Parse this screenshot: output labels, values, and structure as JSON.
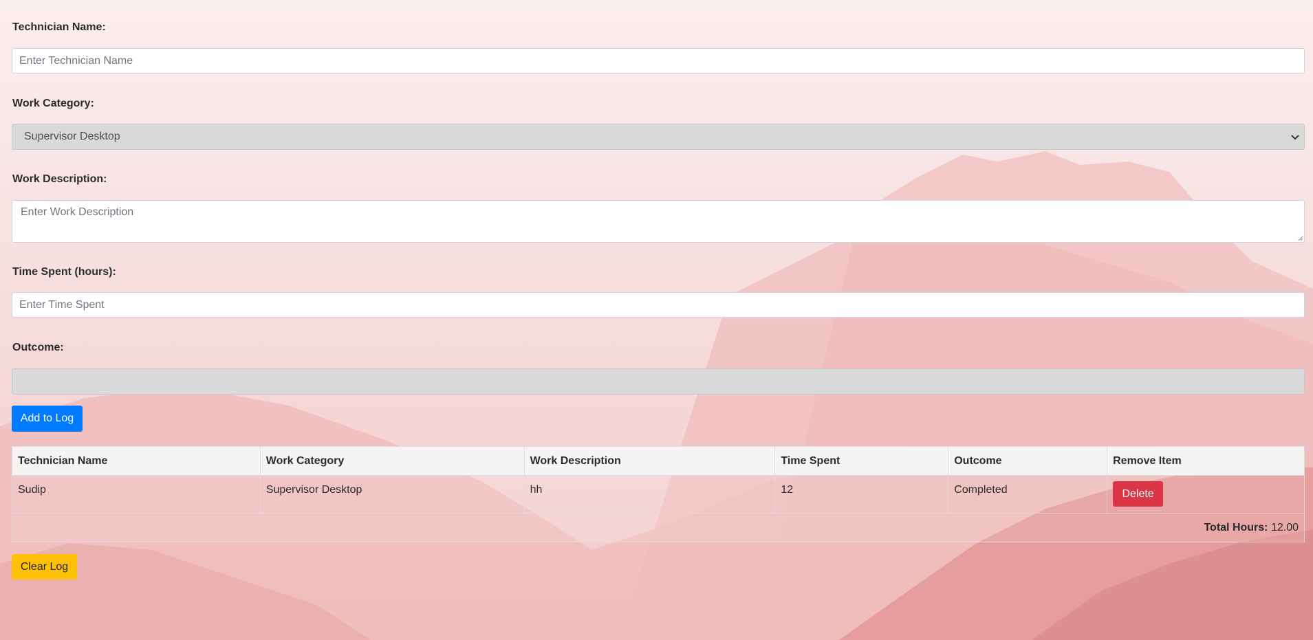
{
  "form": {
    "technician": {
      "label": "Technician Name:",
      "placeholder": "Enter Technician Name",
      "value": ""
    },
    "category": {
      "label": "Work Category:",
      "selected": "Supervisor Desktop"
    },
    "description": {
      "label": "Work Description:",
      "placeholder": "Enter Work Description",
      "value": ""
    },
    "time_spent": {
      "label": "Time Spent (hours):",
      "placeholder": "Enter Time Spent",
      "value": ""
    },
    "outcome": {
      "label": "Outcome:",
      "value": ""
    },
    "add_button_label": "Add to Log"
  },
  "table": {
    "headers": {
      "technician": "Technician Name",
      "category": "Work Category",
      "description": "Work Description",
      "time": "Time Spent",
      "outcome": "Outcome",
      "remove": "Remove Item"
    },
    "rows": [
      {
        "technician": "Sudip",
        "category": "Supervisor Desktop",
        "description": "hh",
        "time": "12",
        "outcome": "Completed",
        "delete_label": "Delete"
      }
    ],
    "total_label": "Total Hours:",
    "total_value": "12.00"
  },
  "clear_button_label": "Clear Log",
  "colors": {
    "primary": "#007bff",
    "danger": "#dc3545",
    "warning": "#ffc107",
    "background": "#f6dada"
  }
}
